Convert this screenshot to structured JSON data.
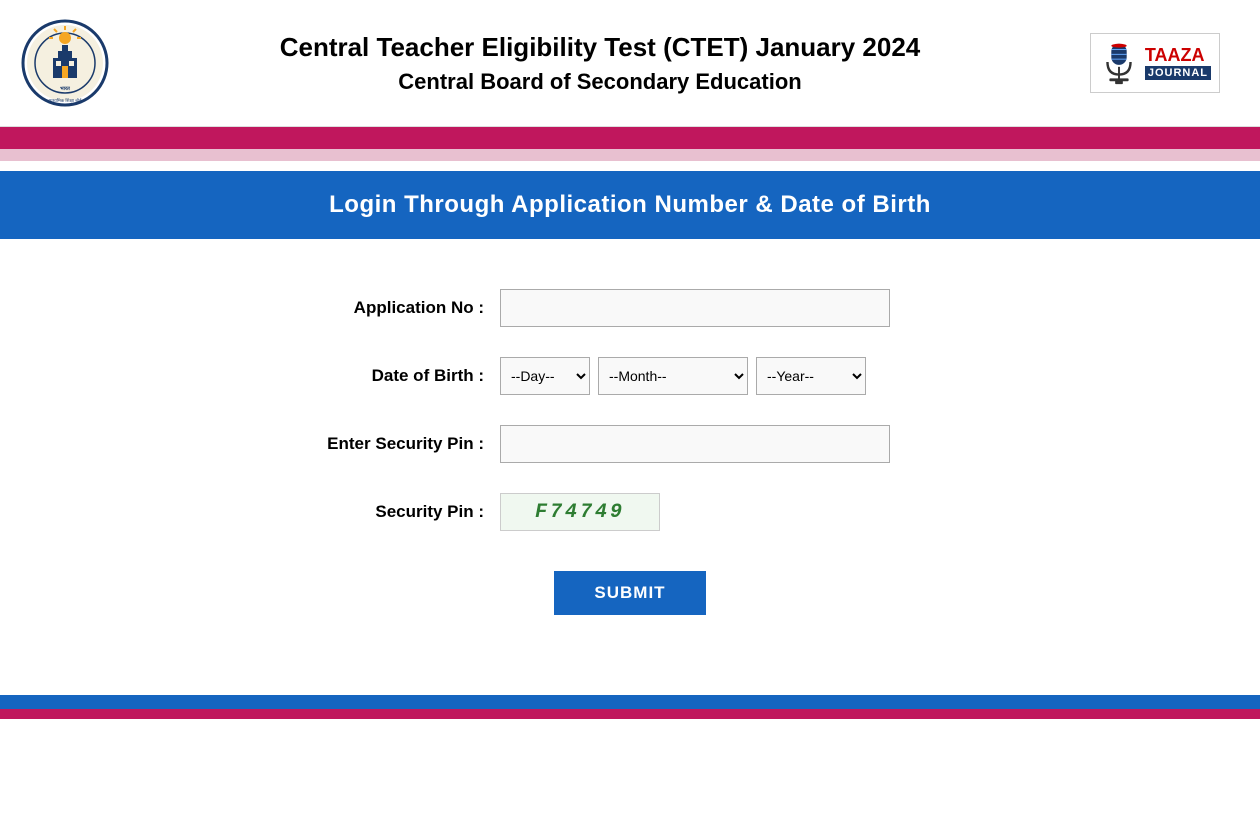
{
  "header": {
    "title1": "Central Teacher Eligibility Test (CTET) January 2024",
    "title2": "Central Board of Secondary Education"
  },
  "banner": {
    "login_title": "Login Through Application Number & Date of Birth"
  },
  "form": {
    "application_no_label": "Application No :",
    "dob_label": "Date of Birth :",
    "security_pin_label": "Enter Security Pin :",
    "captcha_label": "Security Pin :",
    "captcha_value": "F74749",
    "day_default": "--Day--",
    "month_default": "--Month--",
    "year_default": "--Year--",
    "submit_label": "SUBMIT"
  },
  "taaza": {
    "name": "TAAZA",
    "sub": "JOURNAL"
  }
}
